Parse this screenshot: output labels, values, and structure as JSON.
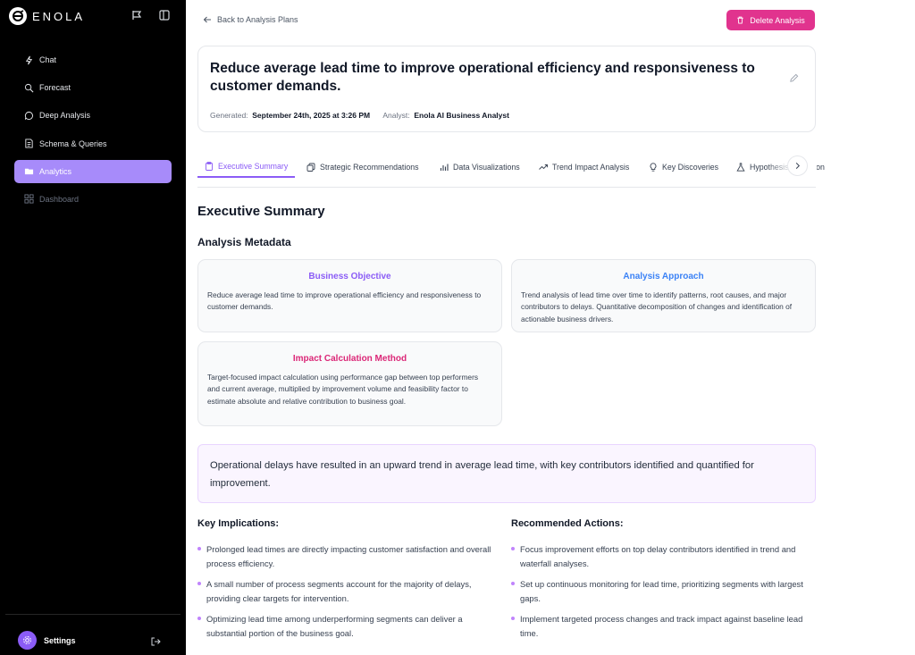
{
  "sidebar": {
    "brand": "ENOLA",
    "items": [
      {
        "label": "Chat",
        "icon": "bolt-icon"
      },
      {
        "label": "Forecast",
        "icon": "search-chart-icon"
      },
      {
        "label": "Deep Analysis",
        "icon": "chat-bubble-icon"
      },
      {
        "label": "Schema & Queries",
        "icon": "document-list-icon"
      },
      {
        "label": "Analytics",
        "icon": "folder-icon",
        "active": true
      },
      {
        "label": "Dashboard",
        "icon": "grid-icon",
        "disabled": true
      }
    ],
    "footer": {
      "settings_label": "Settings"
    }
  },
  "header": {
    "back_label": "Back to Analysis Plans",
    "delete_label": "Delete Analysis"
  },
  "plan": {
    "title": "Reduce average lead time to improve operational efficiency and responsiveness to customer demands.",
    "generated_label": "Generated:",
    "generated_value": "September 24th, 2025 at 3:26 PM",
    "analyst_label": "Analyst:",
    "analyst_value": "Enola AI Business Analyst"
  },
  "tabs": [
    {
      "label": "Executive Summary",
      "icon": "clipboard-icon",
      "active": true
    },
    {
      "label": "Strategic Recommendations",
      "icon": "copy-icon"
    },
    {
      "label": "Data Visualizations",
      "icon": "bar-chart-icon"
    },
    {
      "label": "Trend Impact Analysis",
      "icon": "trending-up-icon"
    },
    {
      "label": "Key Discoveries",
      "icon": "lightbulb-icon"
    },
    {
      "label": "Hypothesis Validation",
      "icon": "flask-icon"
    }
  ],
  "executive": {
    "heading": "Executive Summary",
    "metadata_heading": "Analysis Metadata",
    "cards": {
      "objective": {
        "title": "Business Objective",
        "body": "Reduce average lead time to improve operational efficiency and responsiveness to customer demands."
      },
      "approach": {
        "title": "Analysis Approach",
        "body": "Trend analysis of lead time over time to identify patterns, root causes, and major contributors to delays. Quantitative decomposition of changes and identification of actionable business drivers."
      },
      "impact": {
        "title": "Impact Calculation Method",
        "body": "Target-focused impact calculation using performance gap between top performers and current average, multiplied by improvement volume and feasibility factor to estimate absolute and relative contribution to business goal."
      }
    },
    "summary": "Operational delays have resulted in an upward trend in average lead time, with key contributors identified and quantified for improvement.",
    "implications_heading": "Key Implications:",
    "implications": [
      "Prolonged lead times are directly impacting customer satisfaction and overall process efficiency.",
      "A small number of process segments account for the majority of delays, providing clear targets for intervention.",
      "Optimizing lead time among underperforming segments can deliver a substantial portion of the business goal."
    ],
    "actions_heading": "Recommended Actions:",
    "actions": [
      "Focus improvement efforts on top delay contributors identified in trend and waterfall analyses.",
      "Set up continuous monitoring for lead time, prioritizing segments with largest gaps.",
      "Implement targeted process changes and track impact against baseline lead time."
    ]
  },
  "colors": {
    "accent": "#a78bfa",
    "delete": "#e1338e",
    "objective_title": "#8b5cf6",
    "approach_title": "#3b82f6",
    "impact_title": "#db2777"
  }
}
